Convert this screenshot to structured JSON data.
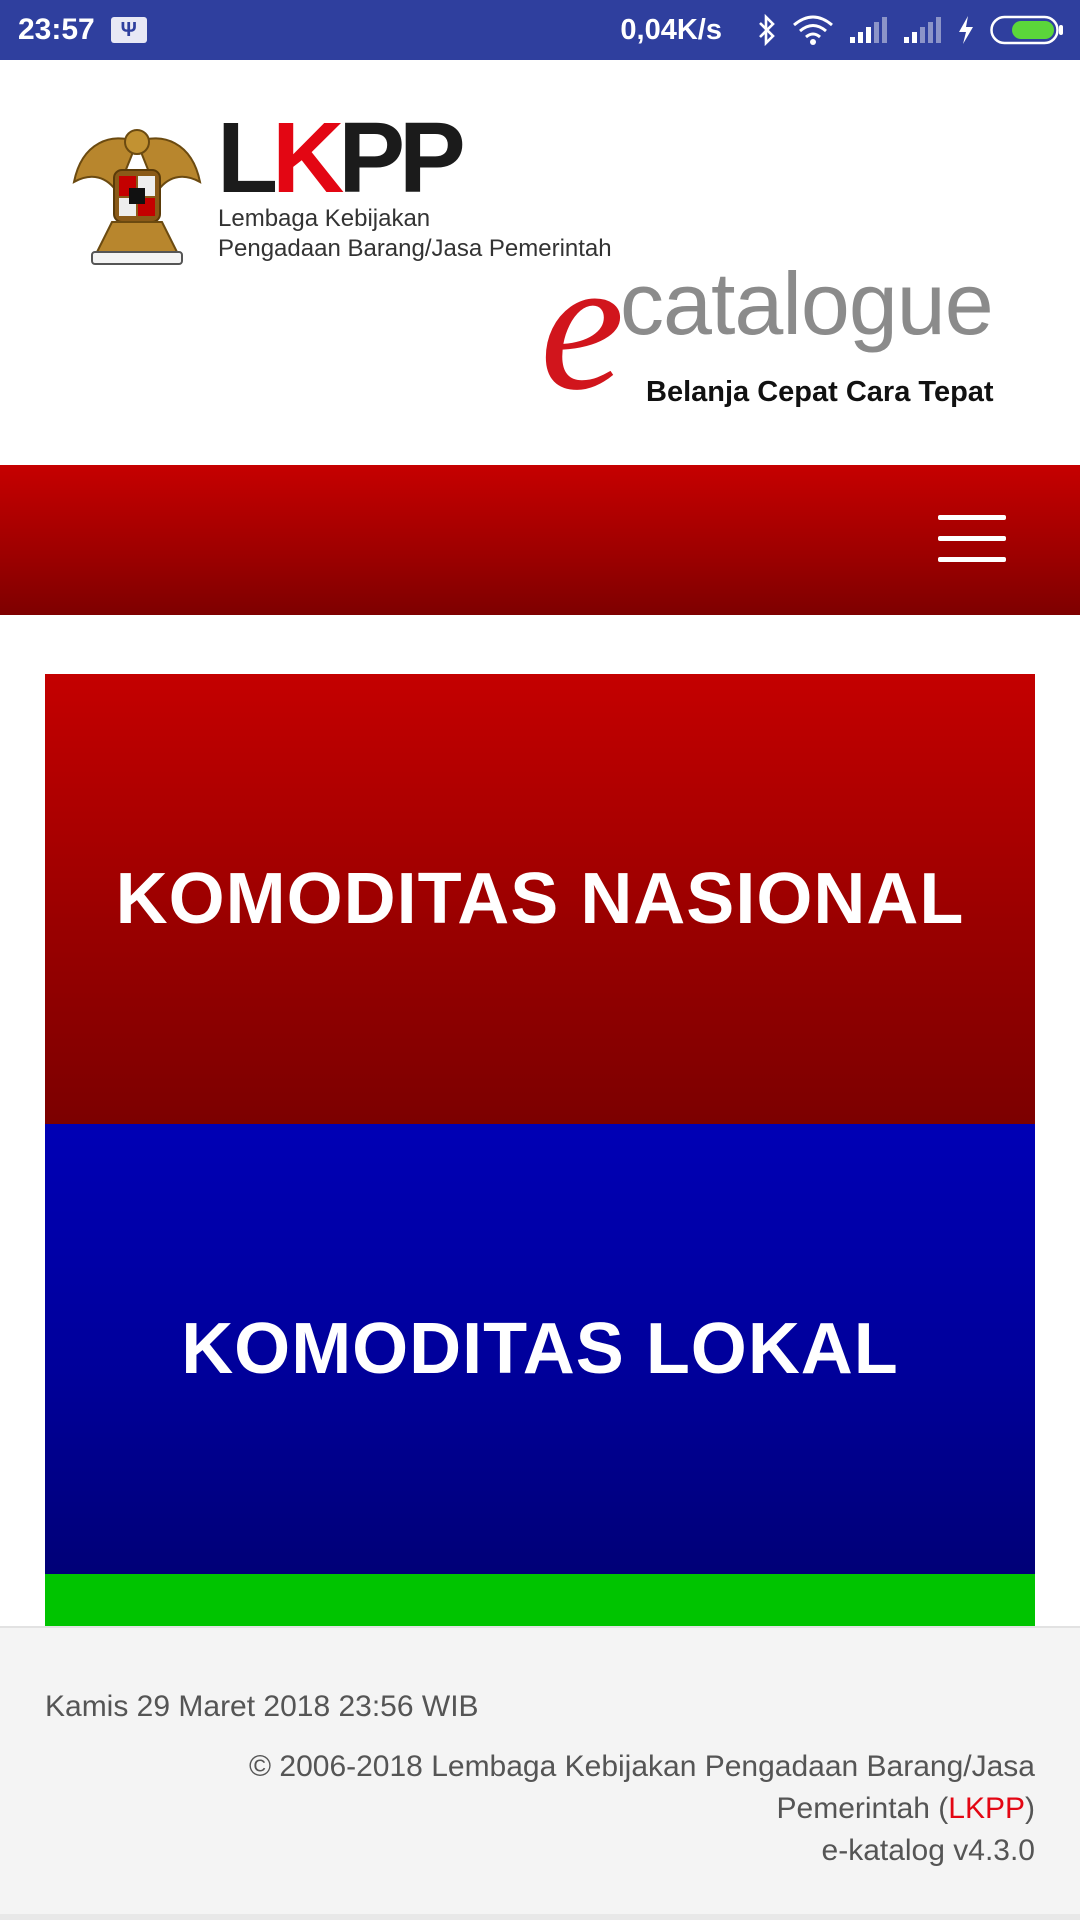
{
  "status_bar": {
    "time": "23:57",
    "notification_icon": "usb-debug-icon",
    "net_speed": "0,04K/s",
    "icons": [
      "bluetooth-icon",
      "wifi-icon",
      "signal-icon",
      "signal-icon",
      "charging-icon",
      "battery-icon"
    ]
  },
  "header": {
    "lkpp_logo": {
      "wordmark": "LKPP",
      "line1": "Lembaga Kebijakan",
      "line2": "Pengadaan Barang/Jasa Pemerintah"
    },
    "ecatalogue_logo": {
      "e": "e",
      "word": "catalogue",
      "tagline": "Belanja Cepat Cara Tepat"
    }
  },
  "navbar": {
    "menu_icon": "hamburger-menu-icon"
  },
  "tiles": {
    "nasional": "KOMODITAS NASIONAL",
    "lokal": "KOMODITAS LOKAL"
  },
  "footer": {
    "date": "Kamis 29 Maret 2018 23:56 WIB",
    "copyright_prefix": "© 2006-2018 Lembaga Kebijakan Pengadaan Barang/Jasa Pemerintah (",
    "copyright_link": "LKPP",
    "copyright_suffix": ")",
    "version": "e-katalog v4.3.0"
  },
  "colors": {
    "status_bar": "#2f3f9e",
    "brand_red": "#c60000",
    "brand_blue": "#0000b5",
    "green": "#00c400",
    "link_red": "#e30613"
  }
}
